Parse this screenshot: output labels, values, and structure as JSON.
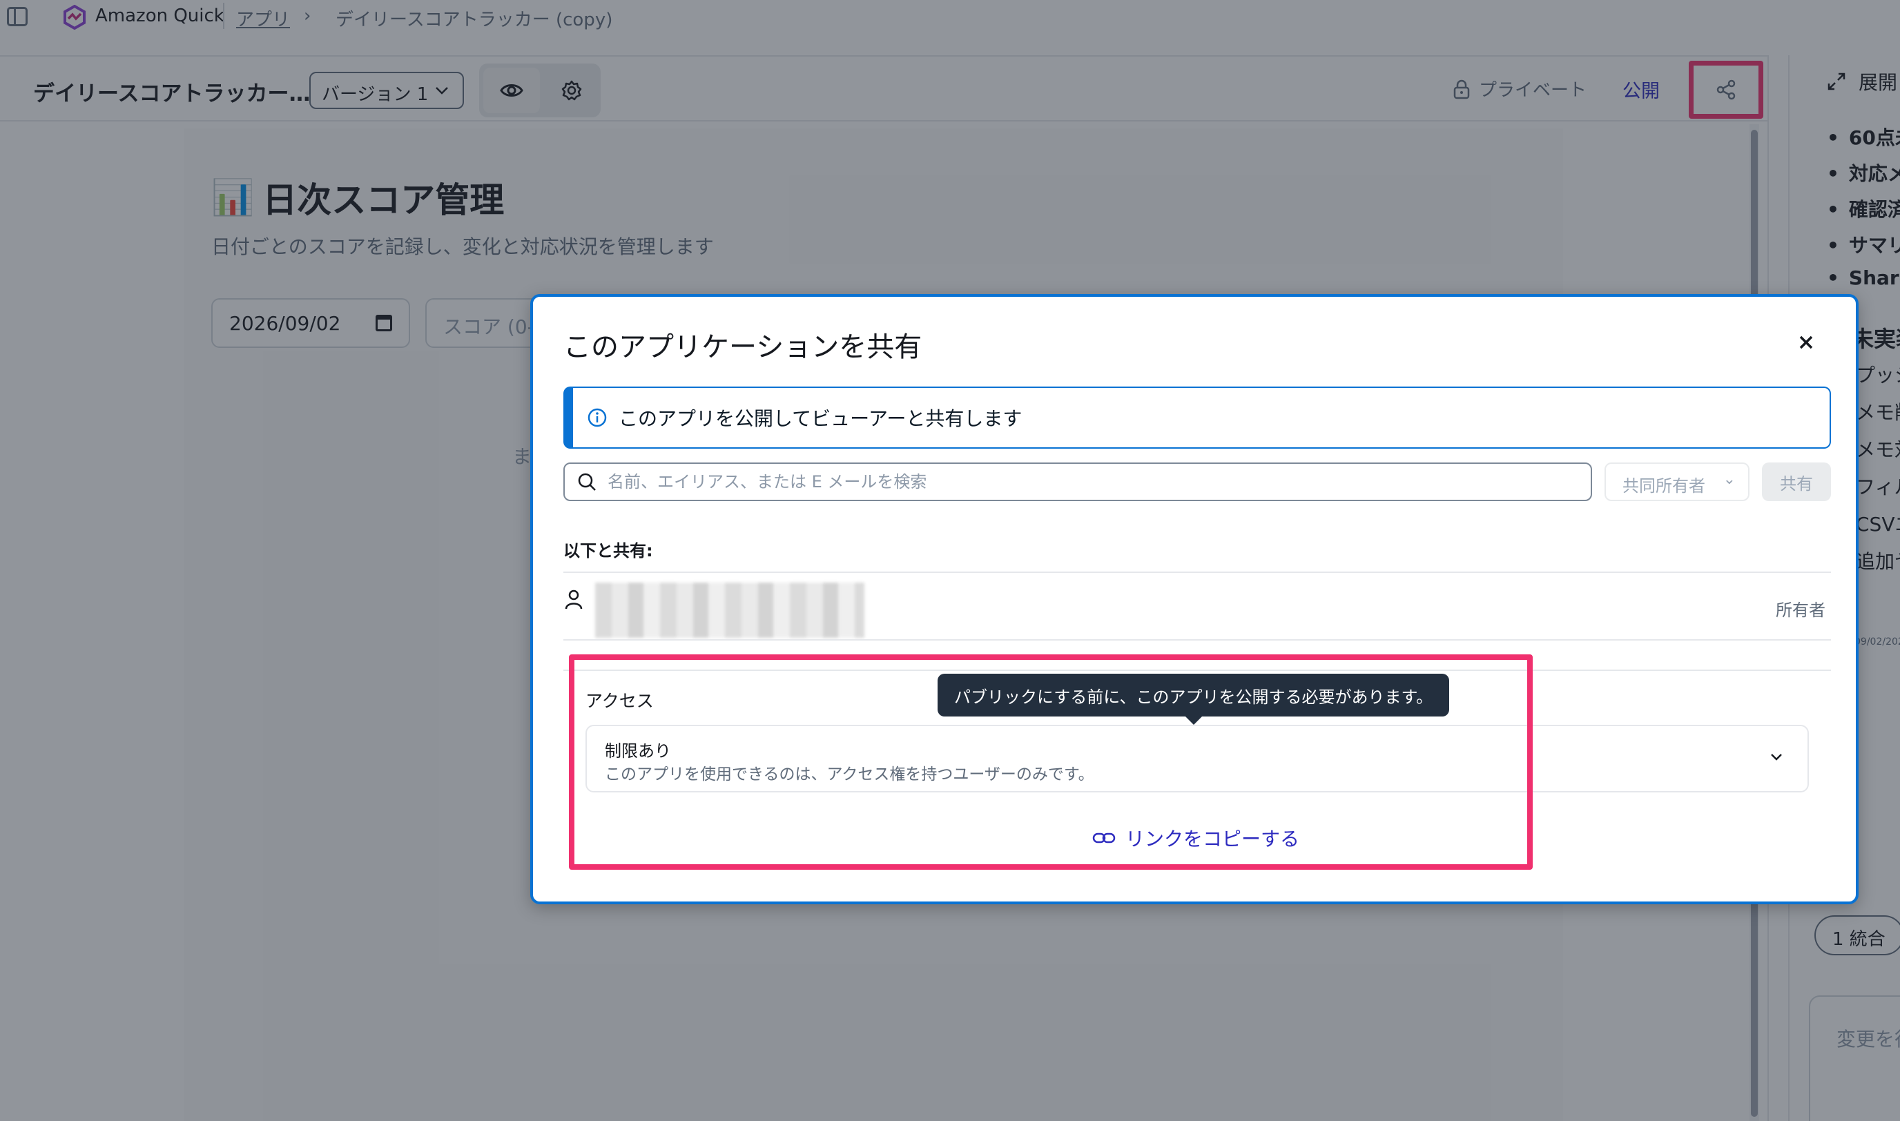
{
  "topbar": {
    "brand": "Amazon Quick",
    "breadcrumb_apps": "アプリ",
    "breadcrumb_current": "デイリースコアトラッカー (copy)"
  },
  "app_header": {
    "title": "デイリースコアトラッカー…",
    "version": "バージョン 1",
    "private_label": "プライベート",
    "publish_label": "公開"
  },
  "main": {
    "page_title_emoji": "📊",
    "page_title": "日次スコア管理",
    "page_subtitle": "日付ごとのスコアを記録し、変化と対応状況を管理します",
    "date_value": "2026/09/02",
    "score_placeholder": "スコア (0-",
    "bg_fragment": "ま"
  },
  "right_panel": {
    "expand_label": "展開",
    "bullets": [
      "60点未",
      "対応メ",
      "確認済",
      "サマリ",
      "Share"
    ],
    "heading": "未実装",
    "lines": [
      "プッシ",
      "メモ削",
      "メモ対",
      "フィル",
      "CSVエ",
      "追加ヤ"
    ],
    "date": "09/02/202",
    "pill": "1 統合",
    "textarea_placeholder": "変更を行"
  },
  "modal": {
    "title": "このアプリケーションを共有",
    "info_text": "このアプリを公開してビューアーと共有します",
    "search_placeholder": "名前、エイリアス、または E メールを検索",
    "role_select": "共同所有者",
    "share_button": "共有",
    "shared_with_label": "以下と共有:",
    "user_role": "所有者",
    "access_label": "アクセス",
    "access_option_title": "制限あり",
    "access_option_desc": "このアプリを使用できるのは、アクセス権を持つユーザーのみです。",
    "copy_link": "リンクをコピーする",
    "tooltip": "パブリックにする前に、このアプリを公開する必要があります。"
  },
  "colors": {
    "accent_blue": "#0972d3",
    "link_purple": "#2d2bbf",
    "highlight_pink": "#f0306e",
    "tooltip_bg": "#232f3e"
  }
}
